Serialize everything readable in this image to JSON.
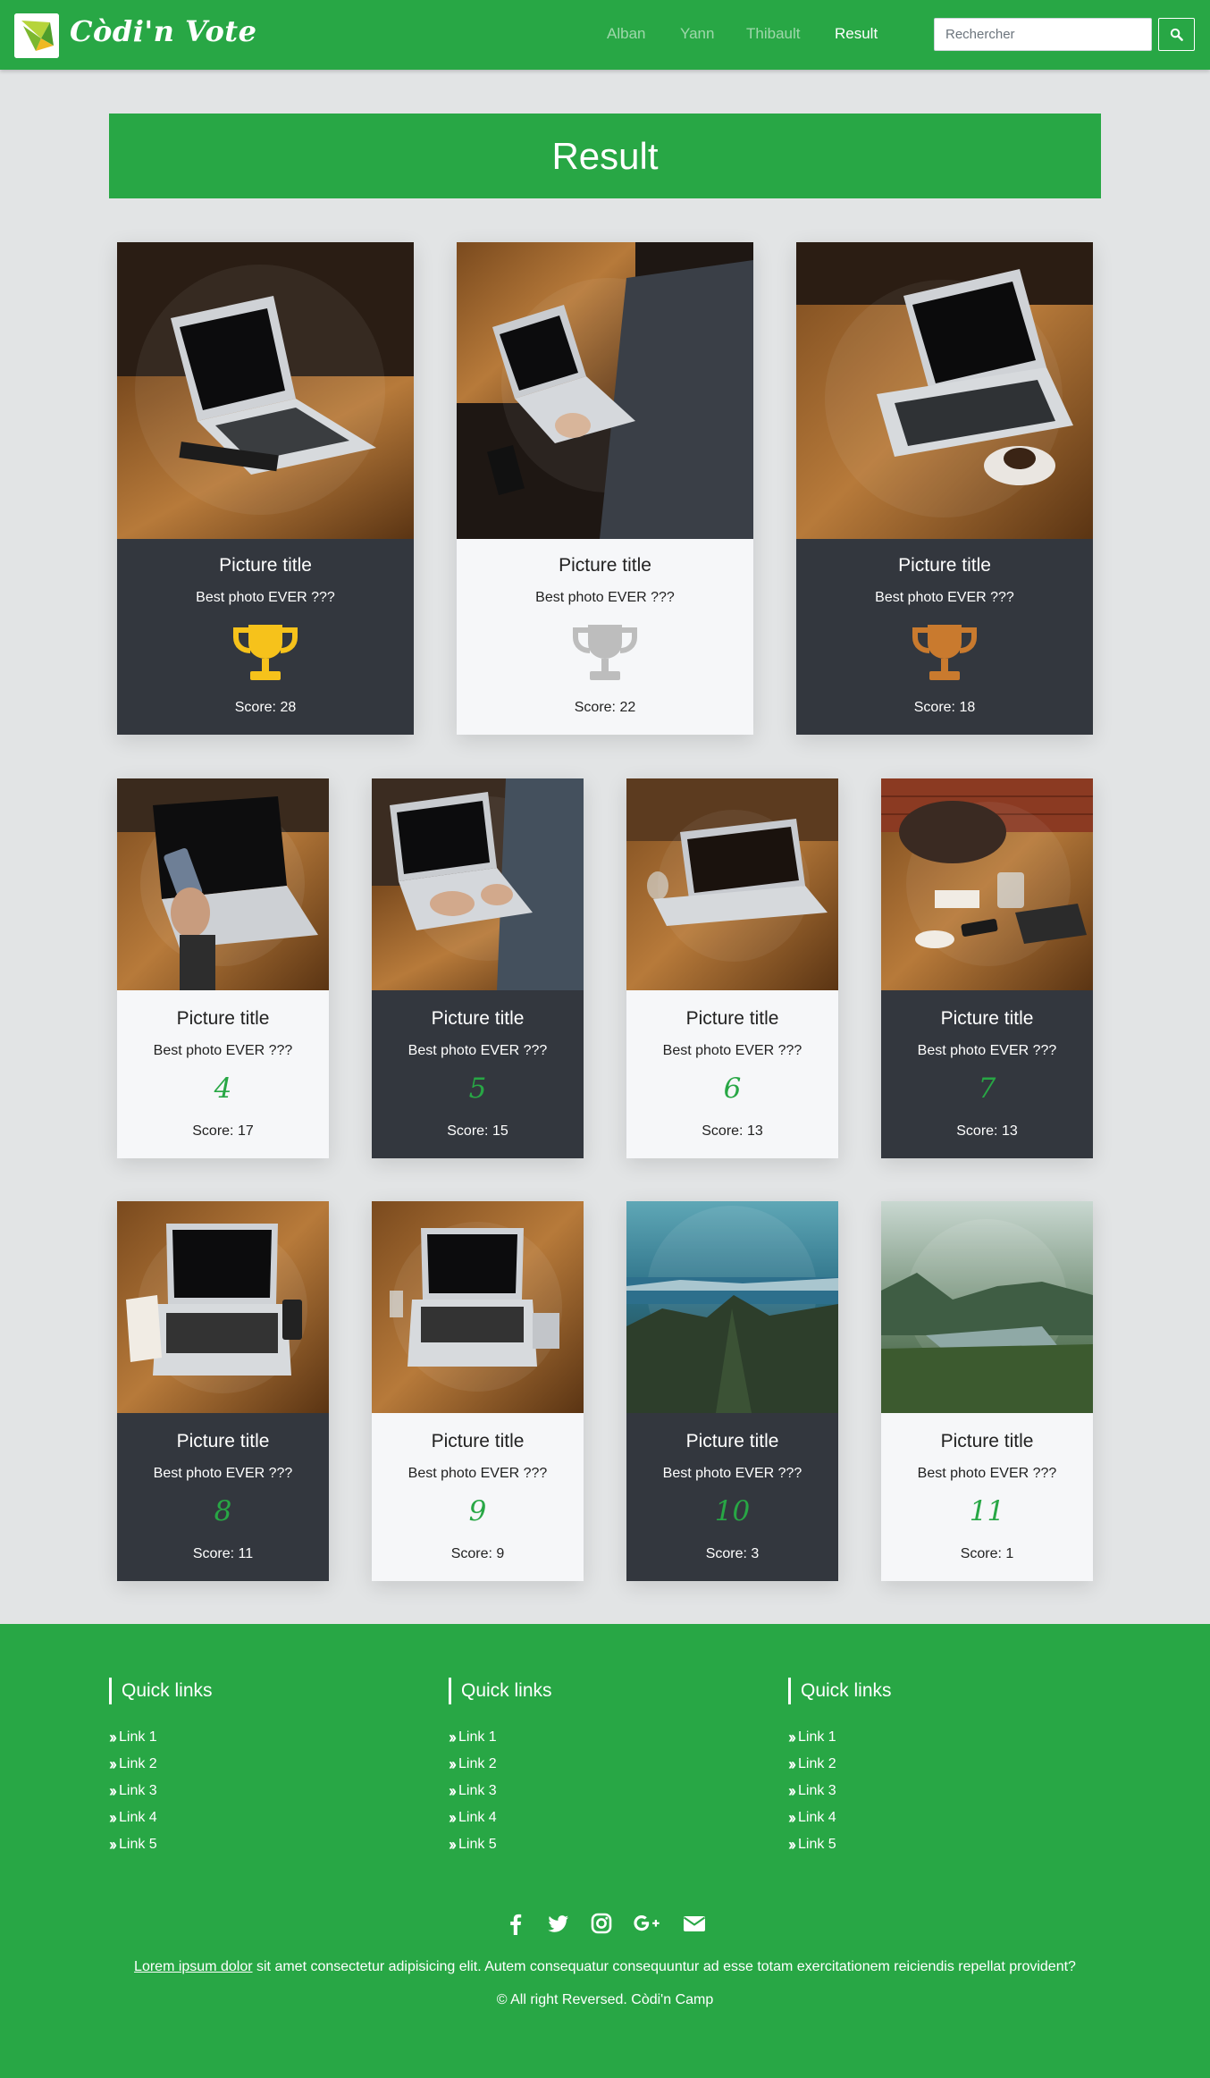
{
  "brand": {
    "name": "Còdi'n Vote"
  },
  "nav": {
    "links": [
      "Alban",
      "Yann",
      "Thibault",
      "Result"
    ],
    "active": "Result",
    "search_placeholder": "Rechercher"
  },
  "banner": {
    "title": "Result"
  },
  "podium": [
    {
      "title": "Picture title",
      "subtitle": "Best photo EVER ???",
      "score": "Score: 28",
      "trophy": "trophy-gold-icon",
      "trophy_color": "#f6c21b",
      "theme": "dark"
    },
    {
      "title": "Picture title",
      "subtitle": "Best photo EVER ???",
      "score": "Score: 22",
      "trophy": "trophy-silver-icon",
      "trophy_color": "#bdbdbd",
      "theme": "light"
    },
    {
      "title": "Picture title",
      "subtitle": "Best photo EVER ???",
      "score": "Score: 18",
      "trophy": "trophy-bronze-icon",
      "trophy_color": "#c97a2e",
      "theme": "dark"
    }
  ],
  "ranked": [
    {
      "rank": "4",
      "title": "Picture title",
      "subtitle": "Best photo EVER ???",
      "score": "Score: 17",
      "theme": "light"
    },
    {
      "rank": "5",
      "title": "Picture title",
      "subtitle": "Best photo EVER ???",
      "score": "Score: 15",
      "theme": "dark"
    },
    {
      "rank": "6",
      "title": "Picture title",
      "subtitle": "Best photo EVER ???",
      "score": "Score: 13",
      "theme": "light"
    },
    {
      "rank": "7",
      "title": "Picture title",
      "subtitle": "Best photo EVER ???",
      "score": "Score: 13",
      "theme": "dark"
    },
    {
      "rank": "8",
      "title": "Picture title",
      "subtitle": "Best photo EVER ???",
      "score": "Score: 11",
      "theme": "dark"
    },
    {
      "rank": "9",
      "title": "Picture title",
      "subtitle": "Best photo EVER ???",
      "score": "Score: 9",
      "theme": "light"
    },
    {
      "rank": "10",
      "title": "Picture title",
      "subtitle": "Best photo EVER ???",
      "score": "Score: 3",
      "theme": "dark"
    },
    {
      "rank": "11",
      "title": "Picture title",
      "subtitle": "Best photo EVER ???",
      "score": "Score: 1",
      "theme": "light"
    }
  ],
  "footer": {
    "columns": [
      {
        "title": "Quick links",
        "links": [
          "Link 1",
          "Link 2",
          "Link 3",
          "Link 4",
          "Link 5"
        ]
      },
      {
        "title": "Quick links",
        "links": [
          "Link 1",
          "Link 2",
          "Link 3",
          "Link 4",
          "Link 5"
        ]
      },
      {
        "title": "Quick links",
        "links": [
          "Link 1",
          "Link 2",
          "Link 3",
          "Link 4",
          "Link 5"
        ]
      }
    ],
    "socials": [
      "facebook-icon",
      "twitter-icon",
      "instagram-icon",
      "google-plus-icon",
      "envelope-icon"
    ],
    "lorem_link": "Lorem ipsum dolor",
    "lorem_text": " sit amet consectetur adipisicing elit. Autem consequatur consequuntur ad esse totam exercitationem reiciendis repellat provident?",
    "copyright": "© All right Reversed.  Còdi'n Camp"
  },
  "colors": {
    "primary": "#28a745",
    "card_dark": "#33373e",
    "card_light": "#f6f7f9",
    "rank": "#28a745"
  }
}
